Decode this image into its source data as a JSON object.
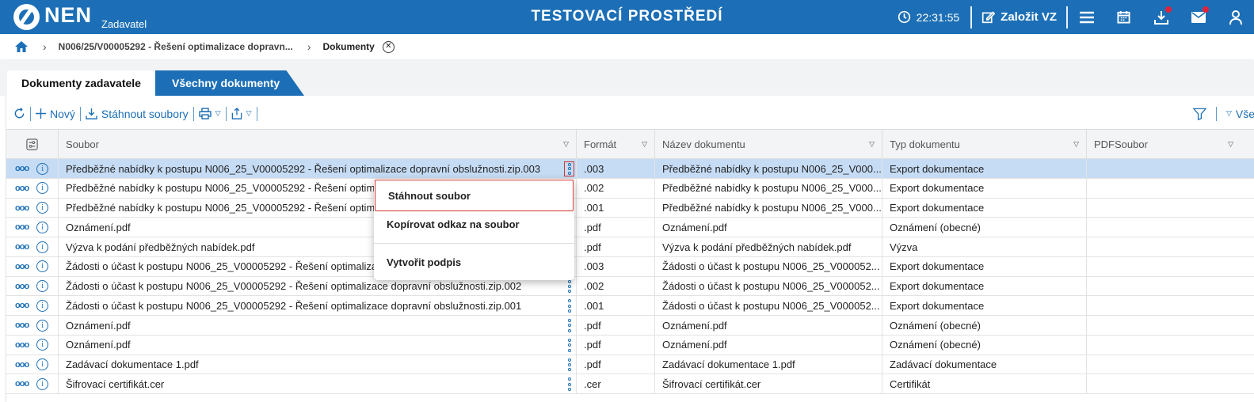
{
  "header": {
    "logo_text": "NEN",
    "logo_sub": "Zadavatel",
    "env_title": "TESTOVACÍ PROSTŘEDÍ",
    "time": "22:31:55",
    "create_label": "Založit VZ",
    "brand_color": "#1c6fb6",
    "notification_color": "#e2233c"
  },
  "breadcrumb": {
    "item1": "N006/25/V00005292 - Řešení optimalizace dopravn...",
    "current": "Dokumenty"
  },
  "tabs": [
    {
      "label": "Dokumenty zadavatele",
      "active": true
    },
    {
      "label": "Všechny dokumenty",
      "active": false
    }
  ],
  "toolbar": {
    "new_label": "Nový",
    "download_label": "Stáhnout soubory",
    "right_label": "Vše"
  },
  "grid": {
    "columns": [
      "Soubor",
      "Formát",
      "Název dokumentu",
      "Typ dokumentu",
      "PDFSoubor"
    ],
    "rows": [
      {
        "soubor": "Předběžné nabídky k postupu N006_25_V00005292 - Řešení optimalizace dopravní obslužnosti.zip.003",
        "format": ".003",
        "nazev": "Předběžné nabídky k postupu N006_25_V000...",
        "typ": "Export dokumentace",
        "pdf": "",
        "selected": true
      },
      {
        "soubor": "Předběžné nabídky k postupu N006_25_V00005292 - Řešení optimal",
        "format": ".002",
        "nazev": "Předběžné nabídky k postupu N006_25_V000...",
        "typ": "Export dokumentace",
        "pdf": ""
      },
      {
        "soubor": "Předběžné nabídky k postupu N006_25_V00005292 - Řešení optimal",
        "format": ".001",
        "nazev": "Předběžné nabídky k postupu N006_25_V000...",
        "typ": "Export dokumentace",
        "pdf": ""
      },
      {
        "soubor": "Oznámení.pdf",
        "format": ".pdf",
        "nazev": "Oznámení.pdf",
        "typ": "Oznámení (obecné)",
        "pdf": ""
      },
      {
        "soubor": "Výzva k podání předběžných nabídek.pdf",
        "format": ".pdf",
        "nazev": "Výzva k podání předběžných nabídek.pdf",
        "typ": "Výzva",
        "pdf": ""
      },
      {
        "soubor": "Žádosti o účast k postupu N006_25_V00005292 - Řešení optimalizac",
        "format": ".003",
        "nazev": "Žádosti o účast k postupu N006_25_V000052...",
        "typ": "Export dokumentace",
        "pdf": ""
      },
      {
        "soubor": "Žádosti o účast k postupu N006_25_V00005292 - Řešení optimalizace dopravní obslužnosti.zip.002",
        "format": ".002",
        "nazev": "Žádosti o účast k postupu N006_25_V000052...",
        "typ": "Export dokumentace",
        "pdf": ""
      },
      {
        "soubor": "Žádosti o účast k postupu N006_25_V00005292 - Řešení optimalizace dopravní obslužnosti.zip.001",
        "format": ".001",
        "nazev": "Žádosti o účast k postupu N006_25_V000052...",
        "typ": "Export dokumentace",
        "pdf": ""
      },
      {
        "soubor": "Oznámení.pdf",
        "format": ".pdf",
        "nazev": "Oznámení.pdf",
        "typ": "Oznámení (obecné)",
        "pdf": ""
      },
      {
        "soubor": "Oznámení.pdf",
        "format": ".pdf",
        "nazev": "Oznámení.pdf",
        "typ": "Oznámení (obecné)",
        "pdf": ""
      },
      {
        "soubor": "Zadávací dokumentace 1.pdf",
        "format": ".pdf",
        "nazev": "Zadávací dokumentace 1.pdf",
        "typ": "Zadávací dokumentace",
        "pdf": ""
      },
      {
        "soubor": "Šifrovací certifikát.cer",
        "format": ".cer",
        "nazev": "Šifrovací certifikát.cer",
        "typ": "Certifikát",
        "pdf": ""
      }
    ]
  },
  "context_menu": {
    "download": "Stáhnout soubor",
    "copy_link": "Kopírovat odkaz na soubor",
    "create_signature": "Vytvořit podpis"
  }
}
